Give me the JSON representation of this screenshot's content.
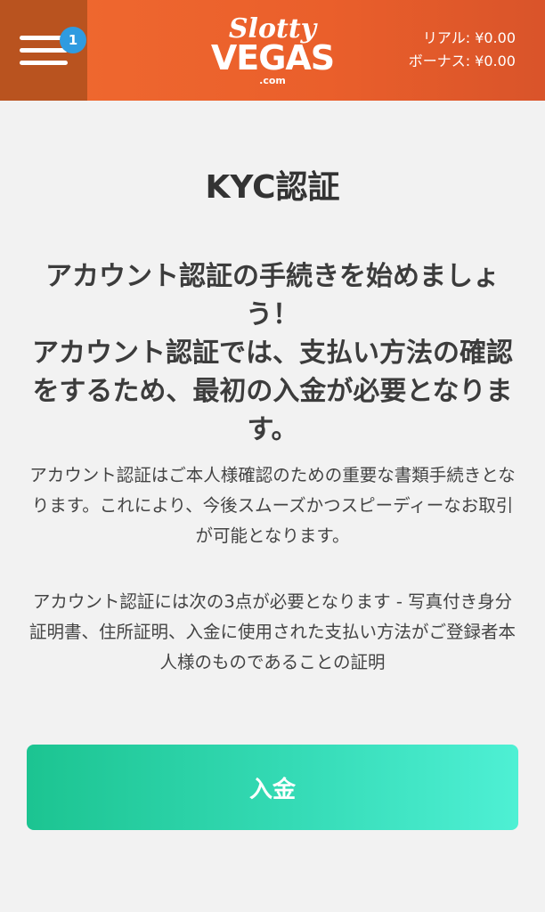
{
  "header": {
    "notification_count": "1",
    "logo": {
      "line1": "Slotty",
      "line2": "VEGAS",
      "line3": ".com"
    },
    "balance_real": "リアル: ¥0.00",
    "balance_bonus": "ボーナス: ¥0.00"
  },
  "main": {
    "title": "KYC認証",
    "subhead_1": "アカウント認証の手続きを始めましょう！",
    "subhead_2": "アカウント認証では、支払い方法の確認をするため、最初の入金が必要となります。",
    "paragraph_1": "アカウント認証はご本人様確認のための重要な書類手続きとなります。これにより、今後スムーズかつスピーディーなお取引が可能となります。",
    "paragraph_2": "アカウント認証には次の3点が必要となります - 写真付き身分証明書、住所証明、入金に使用された支払い方法がご登録者本人様のものであることの証明",
    "deposit_button": "入金"
  },
  "colors": {
    "header": "#ea5f2b",
    "menu_box": "#b9531f",
    "badge": "#2f9be0",
    "button_start": "#1cc491",
    "button_end": "#4ef0d4",
    "background": "#f2f2f2"
  }
}
